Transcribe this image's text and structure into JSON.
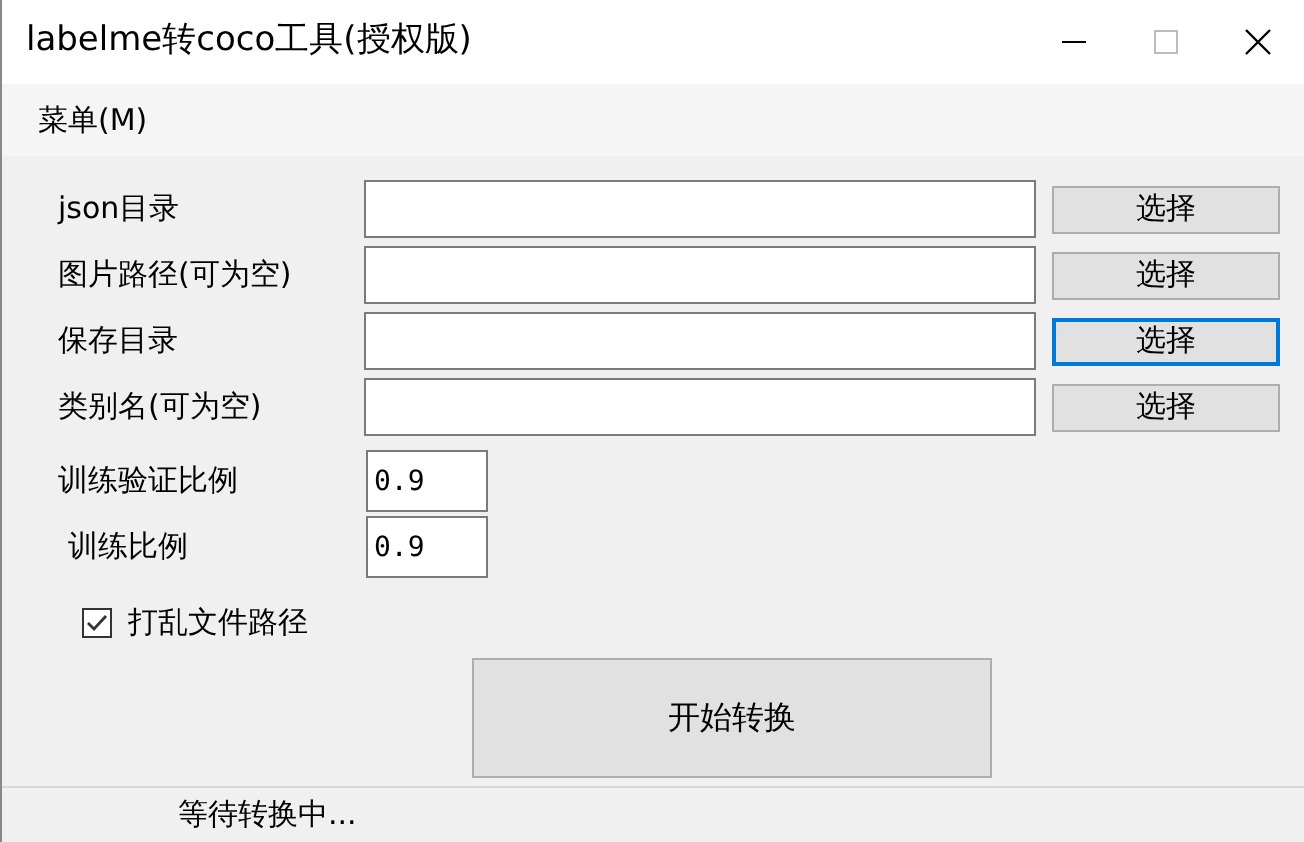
{
  "window": {
    "title": "labelme转coco工具(授权版)"
  },
  "menu": [
    {
      "label": "菜单(M)"
    }
  ],
  "path_rows": [
    {
      "label": "json目录",
      "value": "",
      "button": "选择",
      "focused": false
    },
    {
      "label": "图片路径(可为空)",
      "value": "",
      "button": "选择",
      "focused": false
    },
    {
      "label": "保存目录",
      "value": "",
      "button": "选择",
      "focused": true
    },
    {
      "label": "类别名(可为空)",
      "value": "",
      "button": "选择",
      "focused": false
    }
  ],
  "ratio_rows": [
    {
      "label": "训练验证比例",
      "value": "0.9"
    },
    {
      "label": "训练比例",
      "value": "0.9"
    }
  ],
  "shuffle": {
    "label": "打乱文件路径",
    "checked": true
  },
  "start_button": "开始转换",
  "status_bar": {
    "text": "等待转换中..."
  }
}
